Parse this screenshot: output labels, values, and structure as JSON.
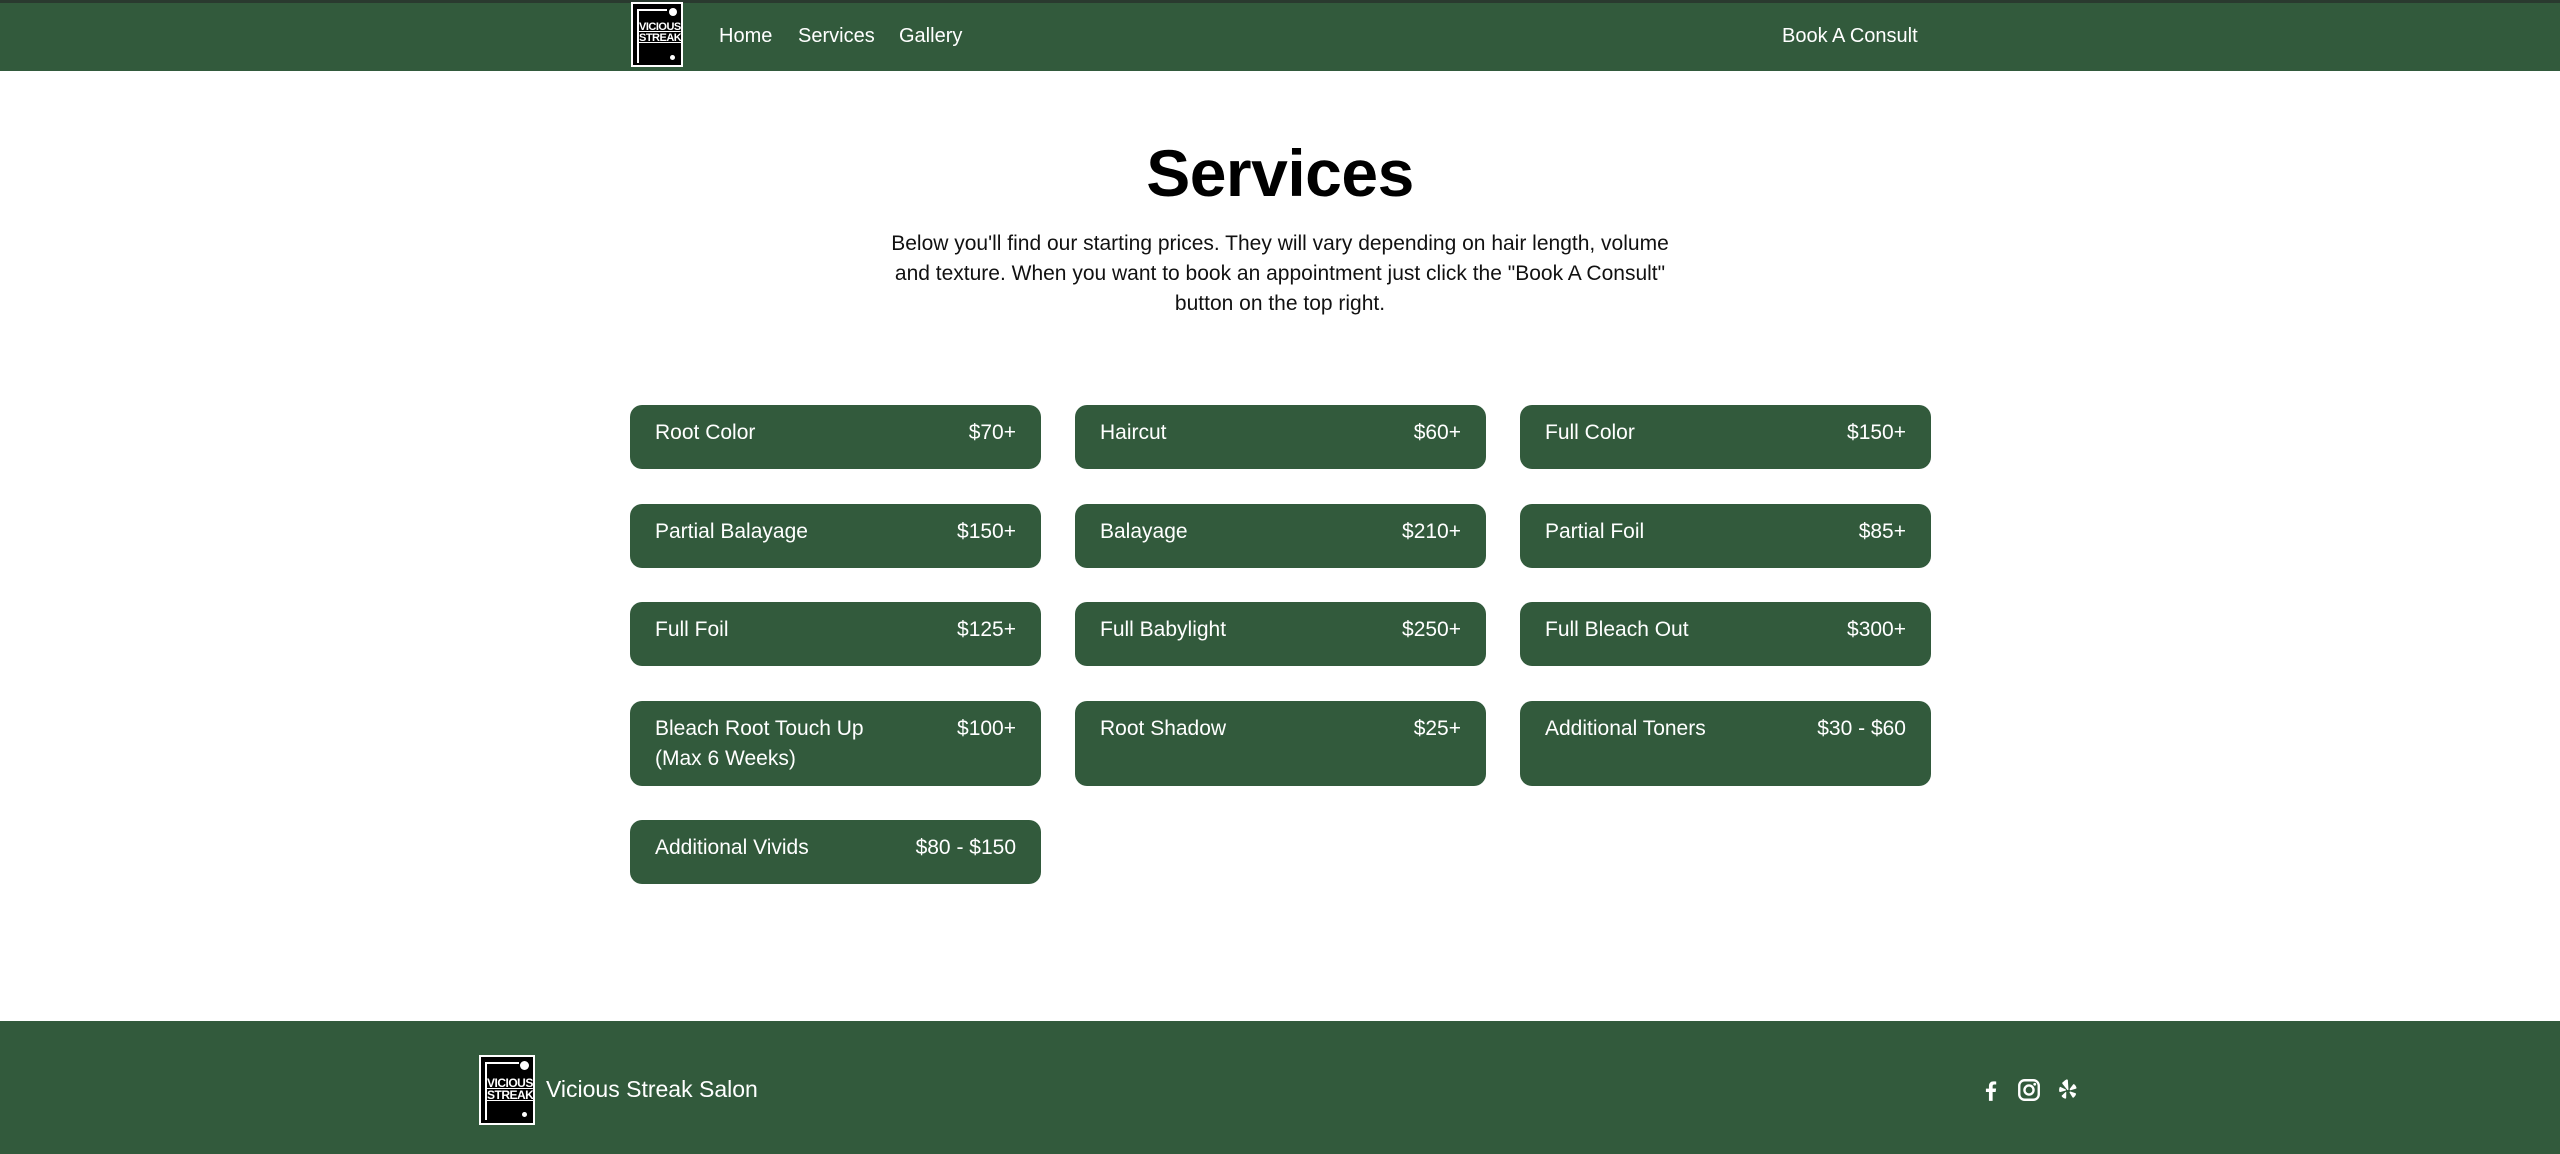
{
  "header": {
    "logo_text": "VICIOUS STREAK",
    "nav": {
      "home": "Home",
      "services": "Services",
      "gallery": "Gallery"
    },
    "cta": "Book A Consult"
  },
  "main": {
    "title": "Services",
    "intro": "Below you'll find our starting prices. They will vary depending on hair length, volume and texture. When you want to book an appointment just click the \"Book A Consult\" button on the top right.",
    "services": [
      {
        "name": "Root Color",
        "price": "$70+"
      },
      {
        "name": "Haircut",
        "price": "$60+"
      },
      {
        "name": "Full Color",
        "price": "$150+"
      },
      {
        "name": "Partial Balayage",
        "price": "$150+"
      },
      {
        "name": "Balayage",
        "price": "$210+"
      },
      {
        "name": "Partial Foil",
        "price": "$85+"
      },
      {
        "name": "Full Foil",
        "price": "$125+"
      },
      {
        "name": "Full Babylight",
        "price": "$250+"
      },
      {
        "name": "Full Bleach Out",
        "price": "$300+"
      },
      {
        "name": "Bleach Root Touch Up (Max 6 Weeks)",
        "price": "$100+"
      },
      {
        "name": "Root Shadow",
        "price": "$25+"
      },
      {
        "name": "Additional Toners",
        "price": "$30 - $60"
      },
      {
        "name": "Additional Vivids",
        "price": "$80 - $150"
      }
    ]
  },
  "footer": {
    "logo_text": "VICIOUS STREAK",
    "salon_name": "Vicious Streak Salon",
    "social": [
      {
        "icon": "facebook-icon"
      },
      {
        "icon": "instagram-icon"
      },
      {
        "icon": "yelp-icon"
      }
    ]
  },
  "colors": {
    "brand_green": "#325a3c",
    "text_on_brand": "#ffffff",
    "background": "#ffffff"
  }
}
